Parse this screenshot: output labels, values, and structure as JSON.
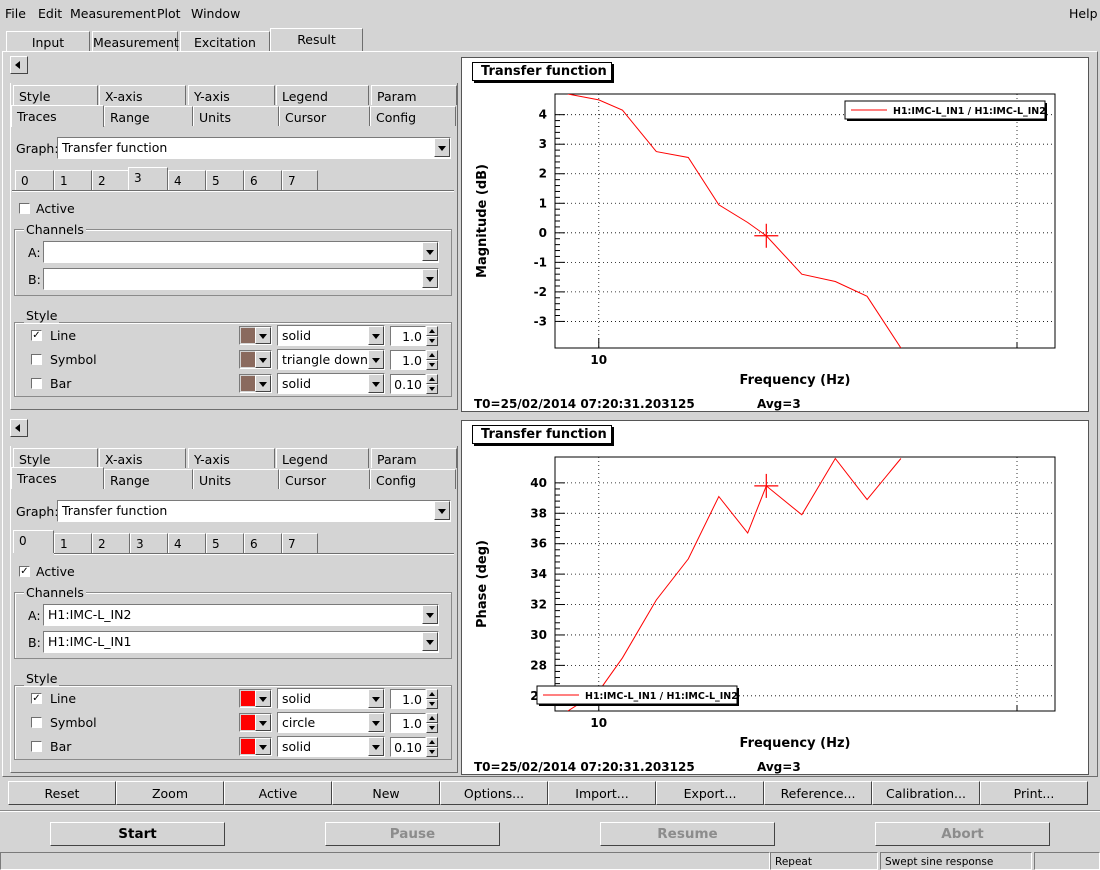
{
  "menu": {
    "items": [
      "File",
      "Edit",
      "Measurement",
      "Plot",
      "Window"
    ],
    "help": "Help"
  },
  "main_tabs": [
    "Input",
    "Measurement",
    "Excitation",
    "Result"
  ],
  "panel_tabs": {
    "row1": [
      "Style",
      "X-axis",
      "Y-axis",
      "Legend",
      "Param"
    ],
    "row2": [
      "Traces",
      "Range",
      "Units",
      "Cursor",
      "Config"
    ]
  },
  "trace_tabs": [
    "0",
    "1",
    "2",
    "3",
    "4",
    "5",
    "6",
    "7"
  ],
  "labels": {
    "graph": "Graph:",
    "active": "Active",
    "channels": "Channels",
    "channel_a": "A:",
    "channel_b": "B:",
    "style": "Style",
    "line": "Line",
    "symbol": "Symbol",
    "bar": "Bar"
  },
  "panel1": {
    "graph_value": "Transfer function",
    "selected_trace": "3",
    "active_checked": false,
    "channel_a": "",
    "channel_b": "",
    "line_checked": true,
    "symbol_checked": false,
    "bar_checked": false,
    "color": "#8a6a5e",
    "line_style": "solid",
    "line_width": "1.0",
    "symbol_style": "triangle down",
    "symbol_width": "1.0",
    "bar_style": "solid",
    "bar_width": "0.10"
  },
  "panel2": {
    "graph_value": "Transfer function",
    "selected_trace": "0",
    "active_checked": true,
    "channel_a": "H1:IMC-L_IN2",
    "channel_b": "H1:IMC-L_IN1",
    "line_checked": true,
    "symbol_checked": false,
    "bar_checked": false,
    "color": "#ff0000",
    "line_style": "solid",
    "line_width": "1.0",
    "symbol_style": "circle",
    "symbol_width": "1.0",
    "bar_style": "solid",
    "bar_width": "0.10"
  },
  "plot1": {
    "title": "Transfer function",
    "footer_t0": "T0=25/02/2014 07:20:31.203125",
    "footer_avg": "Avg=3"
  },
  "plot2": {
    "title": "Transfer function",
    "footer_t0": "T0=25/02/2014 07:20:31.203125",
    "footer_avg": "Avg=3"
  },
  "chart_data": [
    {
      "type": "line",
      "title": "Transfer function",
      "xlabel": "Frequency (Hz)",
      "ylabel": "Magnitude (dB)",
      "xscale": "log",
      "xlim": [
        9.3,
        21.3
      ],
      "ylim": [
        -3.9,
        4.7
      ],
      "xticks": [
        10
      ],
      "yticks": [
        -3,
        -2,
        -1,
        0,
        1,
        2,
        3,
        4
      ],
      "grid": true,
      "legend_position": "top-right",
      "cursor": {
        "x": 13.2,
        "y": -0.1
      },
      "series": [
        {
          "name": "H1:IMC-L_IN1 / H1:IMC-L_IN2",
          "color": "#ff0000",
          "x": [
            9.5,
            10.0,
            10.4,
            11.0,
            11.6,
            12.2,
            12.8,
            13.2,
            14.0,
            14.8,
            15.6,
            16.5
          ],
          "y": [
            4.7,
            4.5,
            4.15,
            2.75,
            2.55,
            0.95,
            0.35,
            -0.1,
            -1.4,
            -1.65,
            -2.15,
            -3.9
          ]
        }
      ]
    },
    {
      "type": "line",
      "title": "Transfer function",
      "xlabel": "Frequency (Hz)",
      "ylabel": "Phase (deg)",
      "xscale": "log",
      "xlim": [
        9.3,
        21.3
      ],
      "ylim": [
        25.0,
        41.7
      ],
      "xticks": [
        10
      ],
      "yticks": [
        26,
        28,
        30,
        32,
        34,
        36,
        38,
        40
      ],
      "grid": true,
      "legend_position": "bottom-left",
      "cursor": {
        "x": 13.2,
        "y": 39.8
      },
      "series": [
        {
          "name": "H1:IMC-L_IN1 / H1:IMC-L_IN2",
          "color": "#ff0000",
          "x": [
            9.5,
            10.0,
            10.4,
            11.0,
            11.6,
            12.2,
            12.8,
            13.2,
            14.0,
            14.8,
            15.6,
            16.5
          ],
          "y": [
            25.0,
            26.3,
            28.5,
            32.3,
            35.0,
            39.1,
            36.7,
            39.8,
            37.9,
            41.6,
            38.9,
            41.6
          ]
        }
      ]
    }
  ],
  "toolbar": [
    "Reset",
    "Zoom",
    "Active",
    "New",
    "Options...",
    "Import...",
    "Export...",
    "Reference...",
    "Calibration...",
    "Print..."
  ],
  "actions": {
    "start": "Start",
    "pause": "Pause",
    "resume": "Resume",
    "abort": "Abort"
  },
  "status": {
    "left": "",
    "repeat": "Repeat",
    "mode": "Swept sine response"
  }
}
